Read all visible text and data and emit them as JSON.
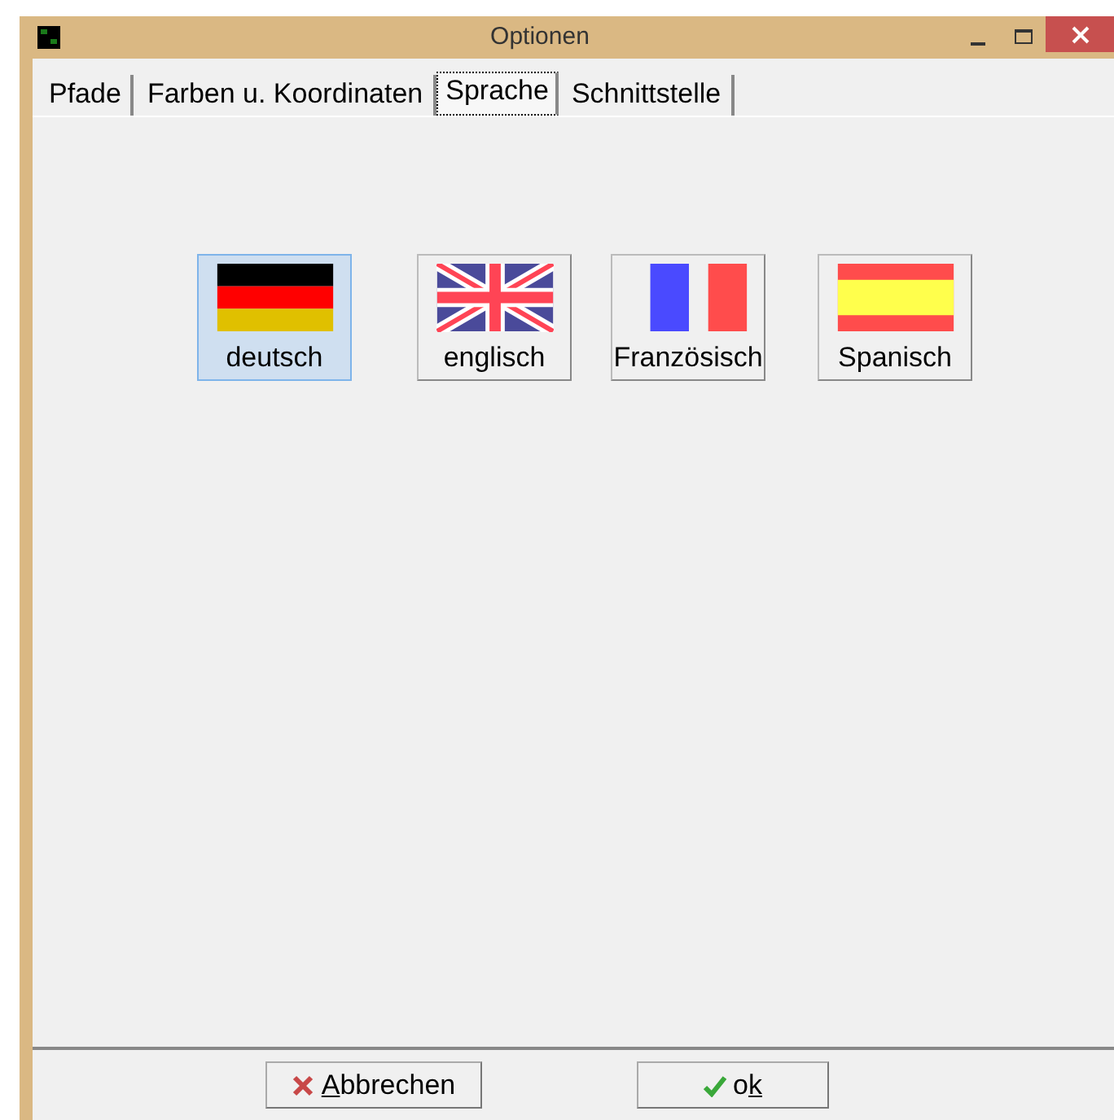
{
  "window": {
    "title": "Optionen"
  },
  "tabs": [
    {
      "label": "Pfade",
      "selected": false
    },
    {
      "label": "Farben u. Koordinaten",
      "selected": false
    },
    {
      "label": "Sprache",
      "selected": true
    },
    {
      "label": "Schnittstelle",
      "selected": false
    }
  ],
  "languages": [
    {
      "kind": "germany",
      "label": "deutsch",
      "selected": true
    },
    {
      "kind": "uk",
      "label": "englisch",
      "selected": false
    },
    {
      "kind": "france",
      "label": "Französisch",
      "selected": false
    },
    {
      "kind": "spain",
      "label": "Spanisch",
      "selected": false
    }
  ],
  "buttons": [
    {
      "kind": "cancel",
      "key": "A",
      "after": "bbrechen"
    },
    {
      "kind": "ok",
      "before": "o",
      "key": "k"
    }
  ]
}
